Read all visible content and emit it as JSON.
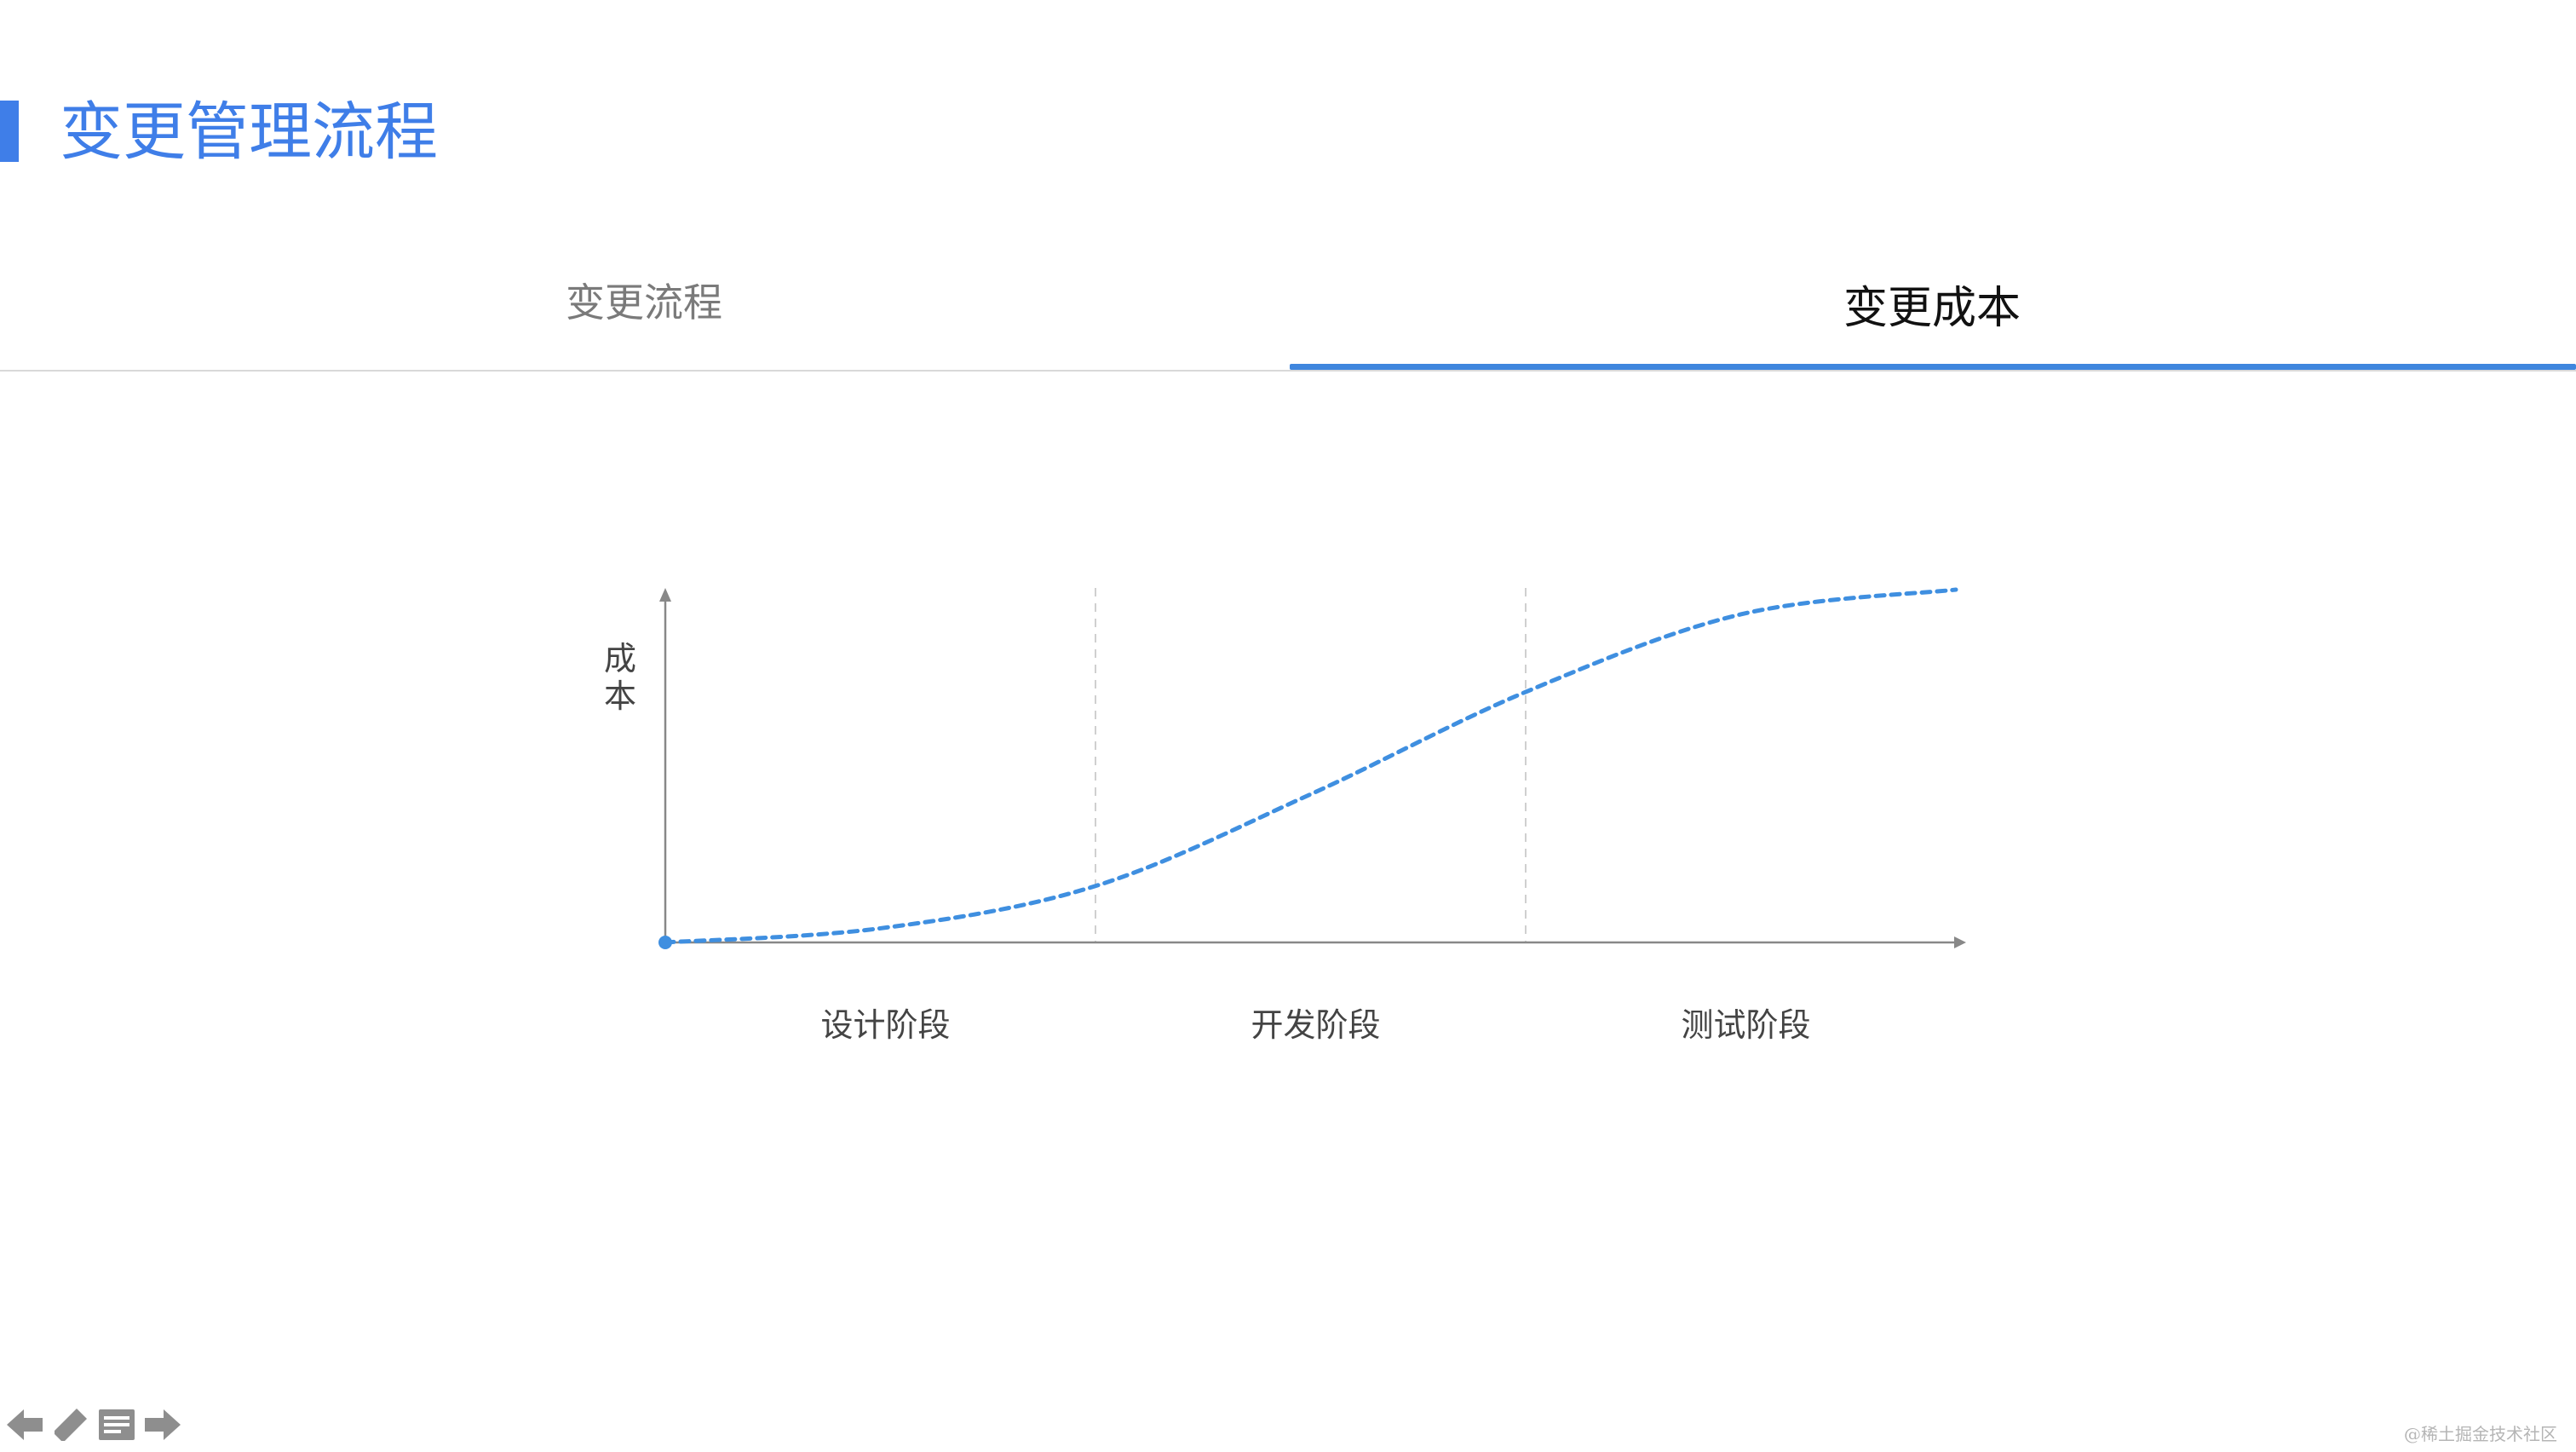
{
  "header": {
    "title": "变更管理流程",
    "accent_color": "#3f7ee8"
  },
  "tabs": [
    {
      "label": "变更流程",
      "active": false
    },
    {
      "label": "变更成本",
      "active": true
    }
  ],
  "chart_data": {
    "type": "line",
    "title": "",
    "xlabel": "",
    "ylabel": "成本",
    "categories": [
      "设计阶段",
      "开发阶段",
      "测试阶段"
    ],
    "x": [
      0,
      0.5,
      1,
      1.5,
      2,
      2.5,
      3
    ],
    "series": [
      {
        "values": [
          0,
          0.04,
          0.16,
          0.42,
          0.71,
          0.93,
          1.0
        ]
      }
    ],
    "xlim": [
      0,
      3
    ],
    "ylim": [
      0,
      1
    ],
    "line_style": "dashed",
    "line_color": "#3f8fe0",
    "phase_dividers": "dashed-vertical",
    "grid": false,
    "legend": "none"
  },
  "toolbar": {
    "icons": [
      "arrow-left-icon",
      "pencil-icon",
      "notes-icon",
      "arrow-right-icon"
    ]
  },
  "watermark": "@稀土掘金技术社区"
}
